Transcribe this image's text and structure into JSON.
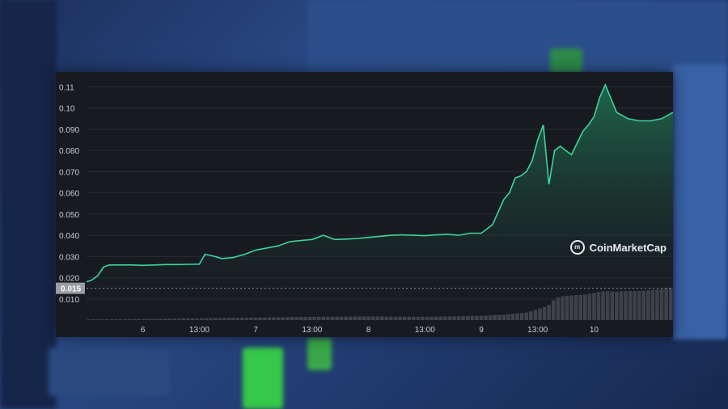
{
  "brand": {
    "name": "CoinMarketCap",
    "icon": "coinmarketcap-logo-icon"
  },
  "colors": {
    "line": "#3ed49a",
    "area_top": "#1f6a4e",
    "area_bottom": "#181a21",
    "volume": "#4a4c55",
    "panel": "#181a21",
    "grid": "#2a2c35",
    "text": "#c8cad2",
    "price_tag": "#9a9ca4"
  },
  "chart_data": {
    "type": "area",
    "current_price_label": "0.015",
    "yticks": [
      "0.11",
      "0.10",
      "0.090",
      "0.080",
      "0.070",
      "0.060",
      "0.050",
      "0.040",
      "0.030",
      "0.020",
      "0.010"
    ],
    "ytick_values": [
      0.11,
      0.1,
      0.09,
      0.08,
      0.07,
      0.06,
      0.05,
      0.04,
      0.03,
      0.02,
      0.01
    ],
    "xticks": [
      "6",
      "13:00",
      "7",
      "13:00",
      "8",
      "13:00",
      "9",
      "13:00",
      "10"
    ],
    "xtick_positions": [
      0.5,
      1.0,
      1.5,
      2.0,
      2.5,
      3.0,
      3.5,
      4.0,
      4.5
    ],
    "grid": true,
    "ylim": [
      0.0,
      0.114
    ],
    "xlim": [
      0.0,
      5.2
    ],
    "series": [
      {
        "x": [
          0.0,
          0.05,
          0.1,
          0.15,
          0.2,
          0.3,
          0.4,
          0.5,
          0.6,
          0.7,
          0.8,
          0.9,
          1.0,
          1.05,
          1.1,
          1.15,
          1.2,
          1.3,
          1.4,
          1.5,
          1.6,
          1.7,
          1.8,
          1.9,
          2.0,
          2.1,
          2.15,
          2.2,
          2.3,
          2.4,
          2.5,
          2.6,
          2.7,
          2.8,
          2.9,
          3.0,
          3.1,
          3.2,
          3.3,
          3.4,
          3.5,
          3.6,
          3.7,
          3.75,
          3.8,
          3.85,
          3.9,
          3.95,
          4.0,
          4.05,
          4.1,
          4.15,
          4.2,
          4.25,
          4.3,
          4.4,
          4.45,
          4.5,
          4.55,
          4.6,
          4.7,
          4.8,
          4.9,
          5.0,
          5.1,
          5.2
        ],
        "y": [
          0.018,
          0.019,
          0.021,
          0.025,
          0.026,
          0.026,
          0.026,
          0.0258,
          0.026,
          0.0262,
          0.0262,
          0.0263,
          0.0264,
          0.031,
          0.0305,
          0.0298,
          0.029,
          0.0295,
          0.031,
          0.033,
          0.034,
          0.035,
          0.037,
          0.0375,
          0.038,
          0.04,
          0.039,
          0.038,
          0.0382,
          0.0385,
          0.039,
          0.0395,
          0.04,
          0.0402,
          0.04,
          0.0398,
          0.0402,
          0.0405,
          0.04,
          0.041,
          0.041,
          0.045,
          0.057,
          0.06,
          0.067,
          0.068,
          0.07,
          0.075,
          0.085,
          0.092,
          0.064,
          0.08,
          0.082,
          0.08,
          0.078,
          0.089,
          0.092,
          0.096,
          0.105,
          0.111,
          0.098,
          0.095,
          0.094,
          0.094,
          0.095,
          0.098
        ]
      }
    ],
    "volume": {
      "x": [
        0.0,
        0.5,
        1.0,
        1.5,
        2.0,
        2.5,
        3.0,
        3.5,
        3.7,
        3.8,
        3.9,
        4.0,
        4.05,
        4.1,
        4.15,
        4.2,
        4.3,
        4.4,
        4.45,
        4.5,
        4.6,
        4.7,
        4.8,
        4.9,
        5.0,
        5.1,
        5.2
      ],
      "values": [
        0.02,
        0.03,
        0.05,
        0.07,
        0.09,
        0.1,
        0.09,
        0.12,
        0.15,
        0.18,
        0.21,
        0.3,
        0.35,
        0.42,
        0.58,
        0.65,
        0.68,
        0.7,
        0.72,
        0.75,
        0.8,
        0.78,
        0.8,
        0.8,
        0.82,
        0.85,
        0.9
      ]
    }
  }
}
